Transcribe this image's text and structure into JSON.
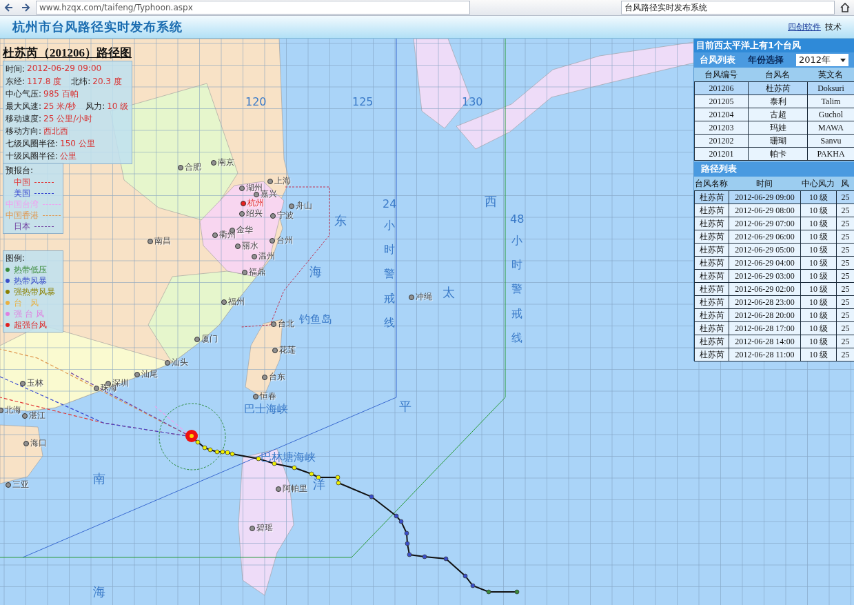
{
  "browser": {
    "url": "www.hzqx.com/taifeng/Typhoon.aspx",
    "search": "台风路径实时发布系统"
  },
  "header": {
    "title": "杭州市台风路径实时发布系统",
    "links": [
      "四创软件",
      "技术"
    ]
  },
  "map": {
    "longitude_labels": [
      "120",
      "125",
      "130"
    ],
    "cities": [
      {
        "name": "合肥",
        "highlighted": false
      },
      {
        "name": "南京",
        "highlighted": false
      },
      {
        "name": "上海",
        "highlighted": false
      },
      {
        "name": "湖州",
        "highlighted": false
      },
      {
        "name": "嘉兴",
        "highlighted": false
      },
      {
        "name": "杭州",
        "highlighted": true
      },
      {
        "name": "绍兴",
        "highlighted": false
      },
      {
        "name": "宁波",
        "highlighted": false
      },
      {
        "name": "舟山",
        "highlighted": false
      },
      {
        "name": "衢州",
        "highlighted": false
      },
      {
        "name": "金华",
        "highlighted": false
      },
      {
        "name": "丽水",
        "highlighted": false
      },
      {
        "name": "台州",
        "highlighted": false
      },
      {
        "name": "温州",
        "highlighted": false
      },
      {
        "name": "福鼎",
        "highlighted": false
      },
      {
        "name": "南昌",
        "highlighted": false
      },
      {
        "name": "福州",
        "highlighted": false
      },
      {
        "name": "台北",
        "highlighted": false
      },
      {
        "name": "厦门",
        "highlighted": false
      },
      {
        "name": "花莲",
        "highlighted": false
      },
      {
        "name": "台东",
        "highlighted": false
      },
      {
        "name": "恒春",
        "highlighted": false
      },
      {
        "name": "汕头",
        "highlighted": false
      },
      {
        "name": "汕尾",
        "highlighted": false
      },
      {
        "name": "深圳",
        "highlighted": false
      },
      {
        "name": "珠海",
        "highlighted": false
      },
      {
        "name": "玉林",
        "highlighted": false
      },
      {
        "name": "北海",
        "highlighted": false
      },
      {
        "name": "湛江",
        "highlighted": false
      },
      {
        "name": "海口",
        "highlighted": false
      },
      {
        "name": "三亚",
        "highlighted": false
      },
      {
        "name": "阿帕里",
        "highlighted": false
      },
      {
        "name": "碧瑶",
        "highlighted": false
      },
      {
        "name": "冲绳",
        "highlighted": false
      }
    ],
    "area_labels": [
      "钓鱼岛",
      "巴士海峡",
      "巴林塘海峡"
    ],
    "sea_labels": [
      "东",
      "海",
      "西",
      "太",
      "平",
      "洋",
      "南",
      "海"
    ],
    "warning_lines": [
      {
        "number": "24",
        "text": "小时警戒线"
      },
      {
        "number": "48",
        "text": "小时警戒线"
      }
    ]
  },
  "info": {
    "title": "杜苏芮（201206）路径图",
    "rows": [
      {
        "fields": [
          {
            "label": "时间:",
            "value": "2012-06-29 09:00"
          }
        ]
      },
      {
        "fields": [
          {
            "label": "东经:",
            "value": "117.8 度"
          },
          {
            "label": "北纬:",
            "value": "20.3 度"
          }
        ]
      },
      {
        "fields": [
          {
            "label": "中心气压:",
            "value": "985 百帕"
          }
        ]
      },
      {
        "fields": [
          {
            "label": "最大风速:",
            "value": "25 米/秒"
          },
          {
            "label": "风力:",
            "value": "10 级"
          }
        ]
      },
      {
        "fields": [
          {
            "label": "移动速度:",
            "value": "25 公里/小时"
          }
        ]
      },
      {
        "fields": [
          {
            "label": "移动方向:",
            "value": "西北西"
          }
        ]
      },
      {
        "fields": [
          {
            "label": "七级风圈半径:",
            "value": "150 公里"
          }
        ]
      },
      {
        "fields": [
          {
            "label": "十级风圈半径:",
            "value": "公里"
          }
        ]
      }
    ]
  },
  "forecasters": {
    "title": "预报台:",
    "items": [
      {
        "name": "中国",
        "color": "#e03838"
      },
      {
        "name": "美国",
        "color": "#3848d0"
      },
      {
        "name": "中国台湾",
        "color": "#f0a0f0"
      },
      {
        "name": "中国香港",
        "color": "#e09850"
      },
      {
        "name": "日本",
        "color": "#7040a0"
      }
    ]
  },
  "legend": {
    "title": "图例:",
    "items": [
      {
        "name": "热带低压",
        "color": "#3a8a3a"
      },
      {
        "name": "热带风暴",
        "color": "#3a4ec8"
      },
      {
        "name": "强热带风暴",
        "color": "#8a8000"
      },
      {
        "name": "台　风",
        "color": "#e8b040"
      },
      {
        "name": "强 台 风",
        "color": "#e080e0"
      },
      {
        "name": "超强台风",
        "color": "#e02020"
      }
    ]
  },
  "panel": {
    "summary": "目前西太平洋上有1个台风",
    "typhoon_list": {
      "title": "台风列表",
      "year_label": "年份选择",
      "year": "2012年",
      "columns": [
        "台风编号",
        "台风名",
        "英文名"
      ],
      "rows": [
        {
          "cells": [
            "201206",
            "杜苏芮",
            "Doksuri"
          ],
          "selected": true
        },
        {
          "cells": [
            "201205",
            "泰利",
            "Talim"
          ],
          "selected": false
        },
        {
          "cells": [
            "201204",
            "古超",
            "Guchol"
          ],
          "selected": false
        },
        {
          "cells": [
            "201203",
            "玛娃",
            "MAWA"
          ],
          "selected": false
        },
        {
          "cells": [
            "201202",
            "珊瑚",
            "Sanvu"
          ],
          "selected": false
        },
        {
          "cells": [
            "201201",
            "帕卡",
            "PAKHA"
          ],
          "selected": false
        }
      ]
    },
    "path_list": {
      "title": "路径列表",
      "columns": [
        "台风名称",
        "时间",
        "中心风力",
        "风"
      ],
      "rows": [
        {
          "cells": [
            "杜苏芮",
            "2012-06-29 09:00",
            "10 级",
            "25"
          ],
          "selected": true
        },
        {
          "cells": [
            "杜苏芮",
            "2012-06-29 08:00",
            "10 级",
            "25"
          ],
          "selected": false
        },
        {
          "cells": [
            "杜苏芮",
            "2012-06-29 07:00",
            "10 级",
            "25"
          ],
          "selected": false
        },
        {
          "cells": [
            "杜苏芮",
            "2012-06-29 06:00",
            "10 级",
            "25"
          ],
          "selected": false
        },
        {
          "cells": [
            "杜苏芮",
            "2012-06-29 05:00",
            "10 级",
            "25"
          ],
          "selected": false
        },
        {
          "cells": [
            "杜苏芮",
            "2012-06-29 04:00",
            "10 级",
            "25"
          ],
          "selected": false
        },
        {
          "cells": [
            "杜苏芮",
            "2012-06-29 03:00",
            "10 级",
            "25"
          ],
          "selected": false
        },
        {
          "cells": [
            "杜苏芮",
            "2012-06-29 02:00",
            "10 级",
            "25"
          ],
          "selected": false
        },
        {
          "cells": [
            "杜苏芮",
            "2012-06-28 23:00",
            "10 级",
            "25"
          ],
          "selected": false
        },
        {
          "cells": [
            "杜苏芮",
            "2012-06-28 20:00",
            "10 级",
            "25"
          ],
          "selected": false
        },
        {
          "cells": [
            "杜苏芮",
            "2012-06-28 17:00",
            "10 级",
            "25"
          ],
          "selected": false
        },
        {
          "cells": [
            "杜苏芮",
            "2012-06-28 14:00",
            "10 级",
            "25"
          ],
          "selected": false
        },
        {
          "cells": [
            "杜苏芮",
            "2012-06-28 11:00",
            "10 级",
            "25"
          ],
          "selected": false
        }
      ]
    }
  }
}
